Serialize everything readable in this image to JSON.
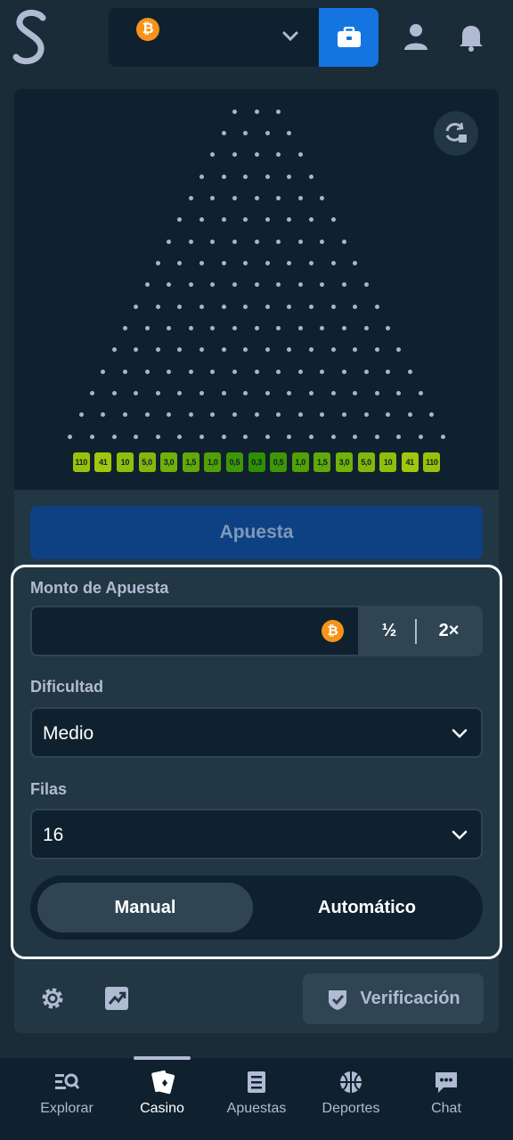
{
  "header": {
    "currency_symbol": "₿",
    "icons": [
      "logo-icon",
      "bitcoin-icon",
      "chevron-down-icon",
      "wallet-icon",
      "user-icon",
      "bell-icon"
    ]
  },
  "board": {
    "swap_icon": "swap-icon",
    "multipliers": [
      "110",
      "41",
      "10",
      "5,0",
      "3,0",
      "1,5",
      "1,0",
      "0,5",
      "0,3",
      "0,5",
      "1,0",
      "1,5",
      "3,0",
      "5,0",
      "10",
      "41",
      "110"
    ],
    "bucket_colors": [
      "#9ac10a",
      "#a1c70c",
      "#8fbf0c",
      "#82b80b",
      "#72b00a",
      "#62a808",
      "#51a006",
      "#3e9704",
      "#2e8f02",
      "#3e9704",
      "#51a006",
      "#62a808",
      "#72b00a",
      "#82b80b",
      "#8fbf0c",
      "#a1c70c",
      "#9ac10a"
    ]
  },
  "bet_button": {
    "label": "Apuesta"
  },
  "form": {
    "amount_label": "Monto de Apuesta",
    "amount_value": "",
    "amount_currency": "₿",
    "half_label": "½",
    "double_label": "2×",
    "difficulty_label": "Dificultad",
    "difficulty_value": "Medio",
    "rows_label": "Filas",
    "rows_value": "16",
    "mode_manual": "Manual",
    "mode_auto": "Automático"
  },
  "tools": {
    "verify_label": "Verificación",
    "icons": [
      "gear-icon",
      "stats-icon",
      "shield-check-icon"
    ]
  },
  "nav": {
    "items": [
      {
        "label": "Explorar",
        "icon": "search-list-icon"
      },
      {
        "label": "Casino",
        "icon": "cards-icon"
      },
      {
        "label": "Apuestas",
        "icon": "list-icon"
      },
      {
        "label": "Deportes",
        "icon": "basketball-icon"
      },
      {
        "label": "Chat",
        "icon": "chat-icon"
      }
    ],
    "active": "Casino"
  },
  "colors": {
    "background": "#1a2c38",
    "panel": "#213743",
    "dark": "#0f212e",
    "accent_blue": "#1475e1",
    "bet_button": "#0e4184",
    "bitcoin": "#f7931a"
  }
}
